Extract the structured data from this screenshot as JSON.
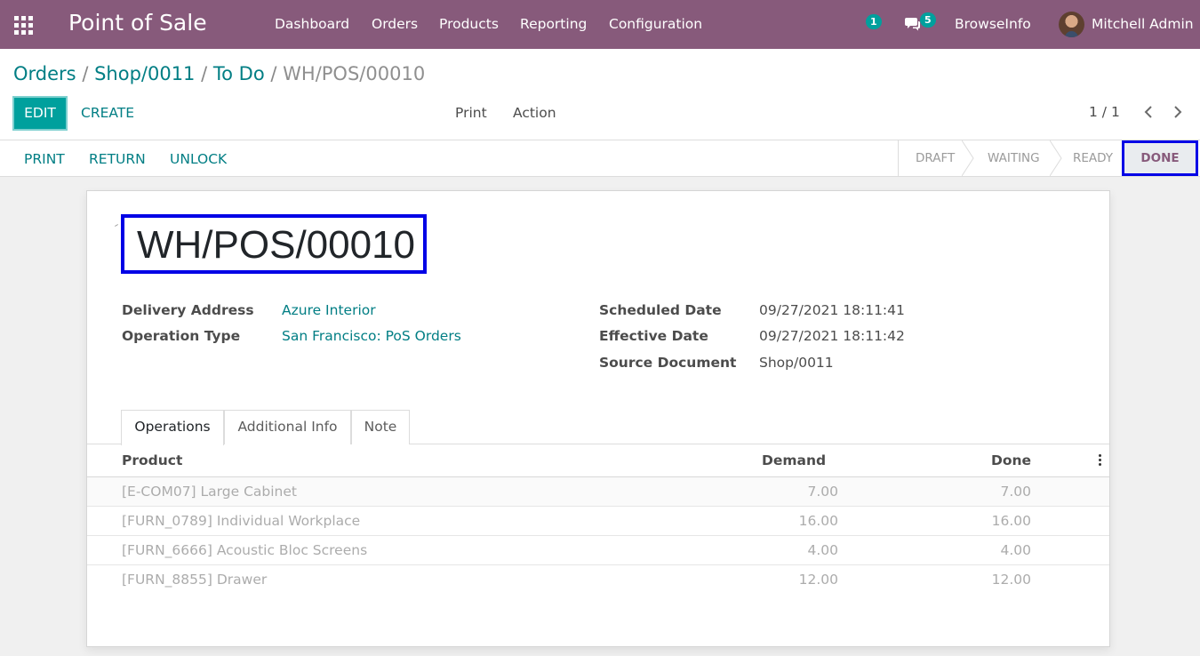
{
  "navbar": {
    "app_title": "Point of Sale",
    "menu": [
      "Dashboard",
      "Orders",
      "Products",
      "Reporting",
      "Configuration"
    ],
    "activity_count": "1",
    "messages_count": "5",
    "company": "BrowseInfo",
    "user": "Mitchell Admin",
    "color": "#875a7b"
  },
  "breadcrumb": {
    "items": [
      "Orders",
      "Shop/0011",
      "To Do"
    ],
    "separator": "/",
    "current": "WH/POS/00010"
  },
  "toolbar": {
    "edit_label": "EDIT",
    "create_label": "CREATE",
    "print_label": "Print",
    "action_label": "Action",
    "pager": "1 / 1"
  },
  "statusbar": {
    "buttons": [
      "PRINT",
      "RETURN",
      "UNLOCK"
    ],
    "stages": [
      "DRAFT",
      "WAITING",
      "READY"
    ],
    "current_stage": "DONE"
  },
  "record": {
    "name": "WH/POS/00010",
    "fields_left": [
      {
        "label": "Delivery Address",
        "value": "Azure Interior"
      },
      {
        "label": "Operation Type",
        "value": "San Francisco: PoS Orders"
      }
    ],
    "fields_right": [
      {
        "label": "Scheduled Date",
        "value": "09/27/2021 18:11:41"
      },
      {
        "label": "Effective Date",
        "value": "09/27/2021 18:11:42"
      },
      {
        "label": "Source Document",
        "value": "Shop/0011"
      }
    ]
  },
  "tabs": [
    "Operations",
    "Additional Info",
    "Note"
  ],
  "operations": {
    "columns": [
      "Product",
      "Demand",
      "Done"
    ],
    "rows": [
      {
        "product": "[E-COM07] Large Cabinet",
        "demand": "7.00",
        "done": "7.00"
      },
      {
        "product": "[FURN_0789] Individual Workplace",
        "demand": "16.00",
        "done": "16.00"
      },
      {
        "product": "[FURN_6666] Acoustic Bloc Screens",
        "demand": "4.00",
        "done": "4.00"
      },
      {
        "product": "[FURN_8855] Drawer",
        "demand": "12.00",
        "done": "12.00"
      }
    ]
  },
  "colors": {
    "accent": "#00a09d",
    "link": "#017e84",
    "highlight_border": "#0000e6"
  },
  "icons": [
    "apps-grid-icon",
    "chat-bubbles-icon",
    "chevron-left-icon",
    "chevron-right-icon",
    "vertical-dots-icon"
  ]
}
